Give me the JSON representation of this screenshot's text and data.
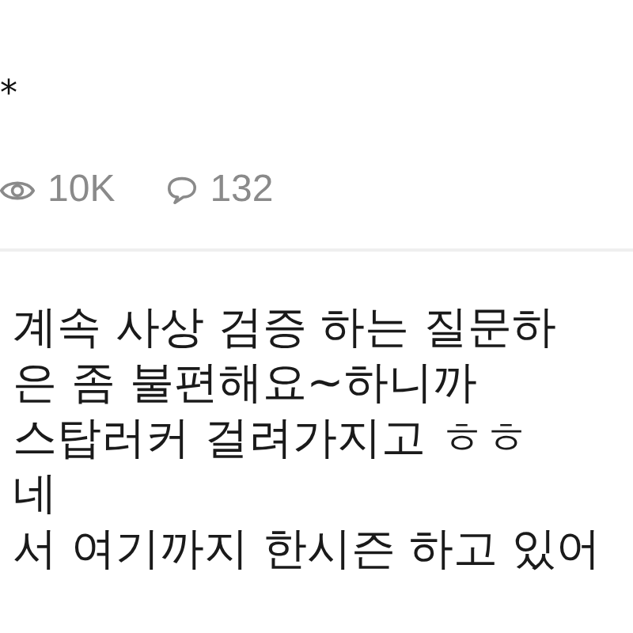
{
  "title_tail": "*",
  "stats": {
    "views": "10K",
    "comments": "132"
  },
  "body_lines": [
    "계속 사상 검증 하는 질문하",
    "은 좀 불편해요~하니까",
    "스탑러커 걸려가지고 ㅎㅎ",
    "네",
    "서 여기까지 한시즌 하고 있어"
  ]
}
